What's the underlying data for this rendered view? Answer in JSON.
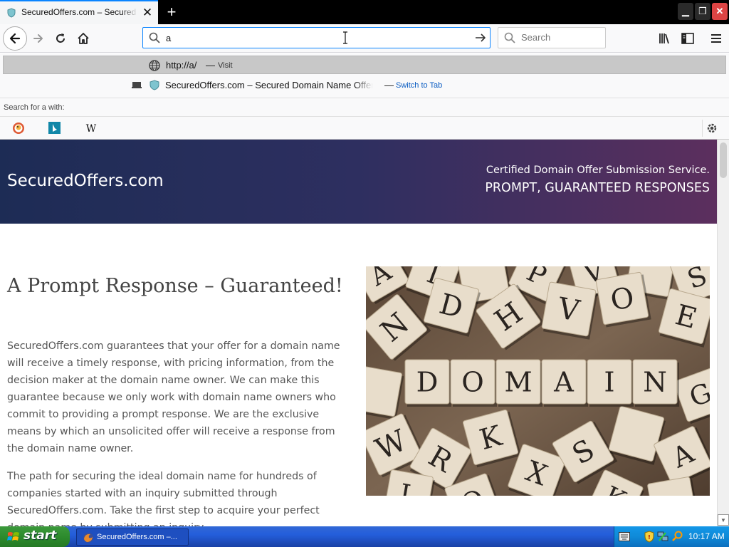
{
  "browser": {
    "tab": {
      "title": "SecuredOffers.com – Secured Domain Name Offer Submission Service"
    },
    "urlbar": {
      "value": "a"
    },
    "searchbar": {
      "placeholder": "Search"
    }
  },
  "dropdown": {
    "row1": {
      "url": "http://a/",
      "separator": "—",
      "action": "Visit"
    },
    "row2": {
      "title": "SecuredOffers.com – Secured Domain Name Offer Submission Service",
      "separator": "—",
      "action": "Switch to Tab"
    },
    "search_for_label": "Search for a with:",
    "engines": [
      "duckduckgo-icon",
      "bing-icon",
      "wikipedia-icon"
    ]
  },
  "page": {
    "site_title": "SecuredOffers.com",
    "tagline_1": "Certified Domain Offer Submission Service.",
    "tagline_2": "PROMPT, GUARANTEED RESPONSES",
    "headline": "A Prompt Response – Guaranteed!",
    "para_1": "SecuredOffers.com guarantees that your offer for a domain name will receive a timely response, with pricing information, from the decision maker at the domain name owner.  We can make this guarantee because we only work with domain name owners who commit to providing a prompt response. We are the exclusive means by which an unsolicited offer will receive a response from the domain name owner.",
    "para_2": "The path for securing the ideal domain name for hundreds of companies started with an inquiry submitted through SecuredOffers.com.  Take the first step to acquire your perfect domain name by submitting an inquiry.",
    "image_word": "DOMAIN",
    "hero_colors": [
      "#1d2c55",
      "#5c2f5e"
    ]
  },
  "taskbar": {
    "start_label": "start",
    "task_label": "SecuredOffers.com –...",
    "clock": "10:17 AM"
  }
}
